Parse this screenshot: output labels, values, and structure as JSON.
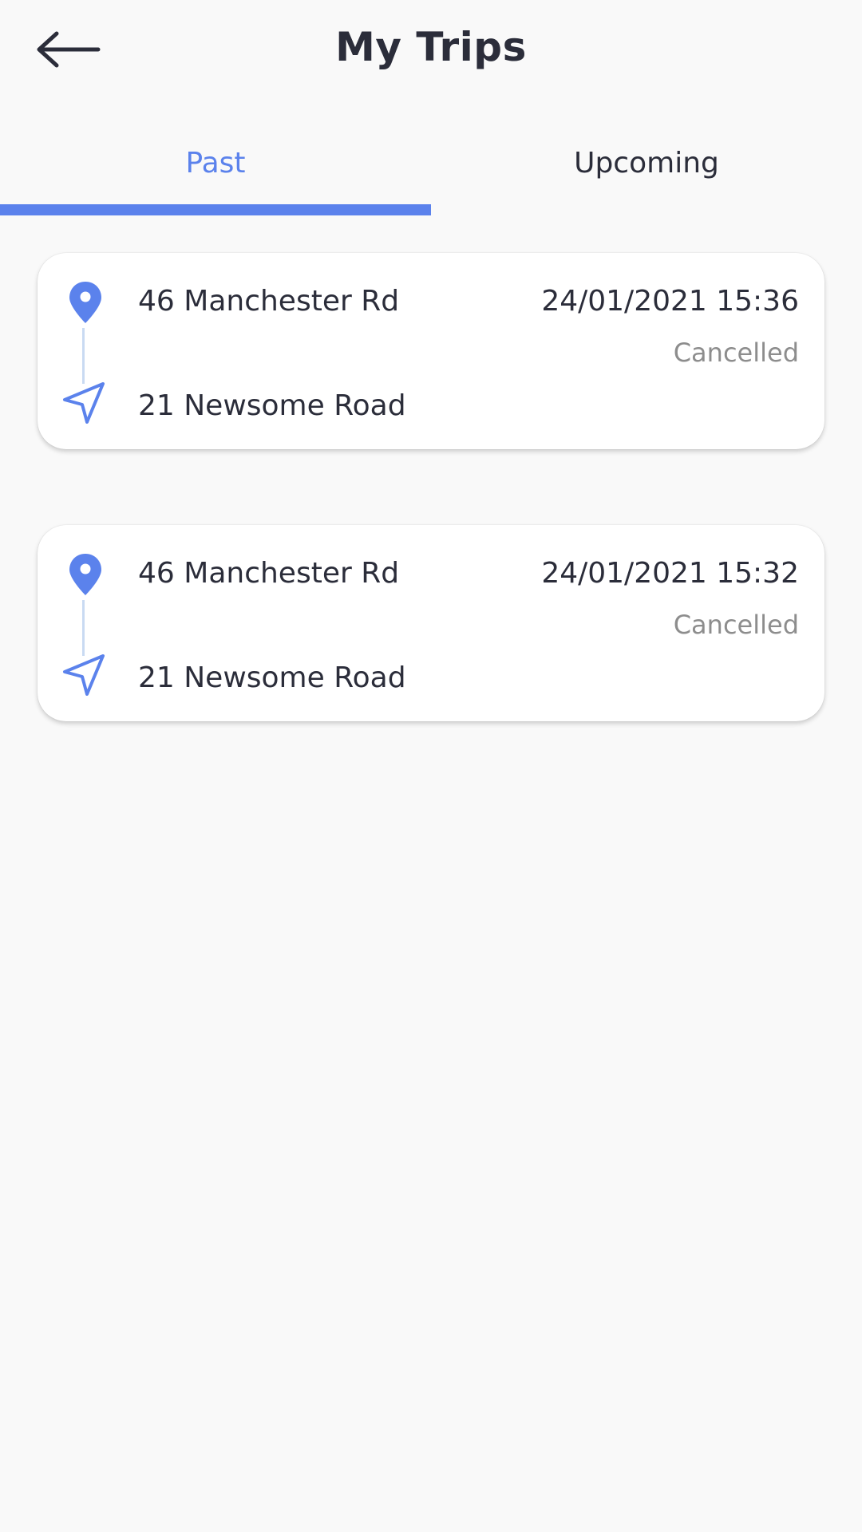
{
  "header": {
    "title": "My Trips",
    "back_icon": "arrow-left-icon"
  },
  "tabs": [
    {
      "label": "Past",
      "active": true
    },
    {
      "label": "Upcoming",
      "active": false
    }
  ],
  "colors": {
    "accent": "#5b82ec",
    "text": "#2b2d3a",
    "muted": "#8d8d8d",
    "route_line": "#c9daf2",
    "background": "#f9f9f9"
  },
  "trips": [
    {
      "pickup": "46 Manchester Rd",
      "dropoff": "21 Newsome Road",
      "datetime": "24/01/2021 15:36",
      "status": "Cancelled",
      "pickup_icon": "map-pin-icon",
      "dropoff_icon": "navigation-arrow-icon"
    },
    {
      "pickup": "46 Manchester Rd",
      "dropoff": "21 Newsome Road",
      "datetime": "24/01/2021 15:32",
      "status": "Cancelled",
      "pickup_icon": "map-pin-icon",
      "dropoff_icon": "navigation-arrow-icon"
    }
  ]
}
